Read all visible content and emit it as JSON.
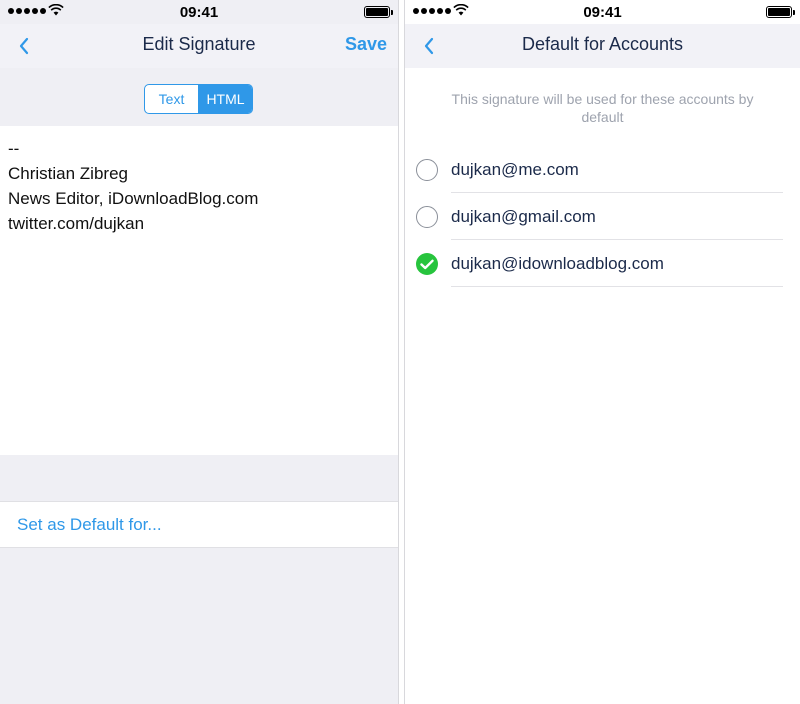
{
  "status_bar": {
    "time": "09:41"
  },
  "edit_signature": {
    "back_icon": "chevron-left-icon",
    "title": "Edit Signature",
    "save_label": "Save",
    "segments": [
      {
        "label": "Text",
        "selected": false
      },
      {
        "label": "HTML",
        "selected": true
      }
    ],
    "signature_lines": [
      "--",
      "Christian Zibreg",
      "News Editor, iDownloadBlog.com",
      "twitter.com/dujkan"
    ],
    "set_default_label": "Set as Default for..."
  },
  "default_for_accounts": {
    "back_icon": "chevron-left-icon",
    "title": "Default for Accounts",
    "hint": "This signature will be used for these accounts by default",
    "accounts": [
      {
        "email": "dujkan@me.com",
        "checked": false
      },
      {
        "email": "dujkan@gmail.com",
        "checked": false
      },
      {
        "email": "dujkan@idownloadblog.com",
        "checked": true
      }
    ]
  },
  "colors": {
    "accent": "#2f98e8",
    "check": "#27c43d",
    "nav_bg": "#f2f2f7",
    "group_bg": "#efeff4",
    "title_text": "#1b2a4a"
  }
}
